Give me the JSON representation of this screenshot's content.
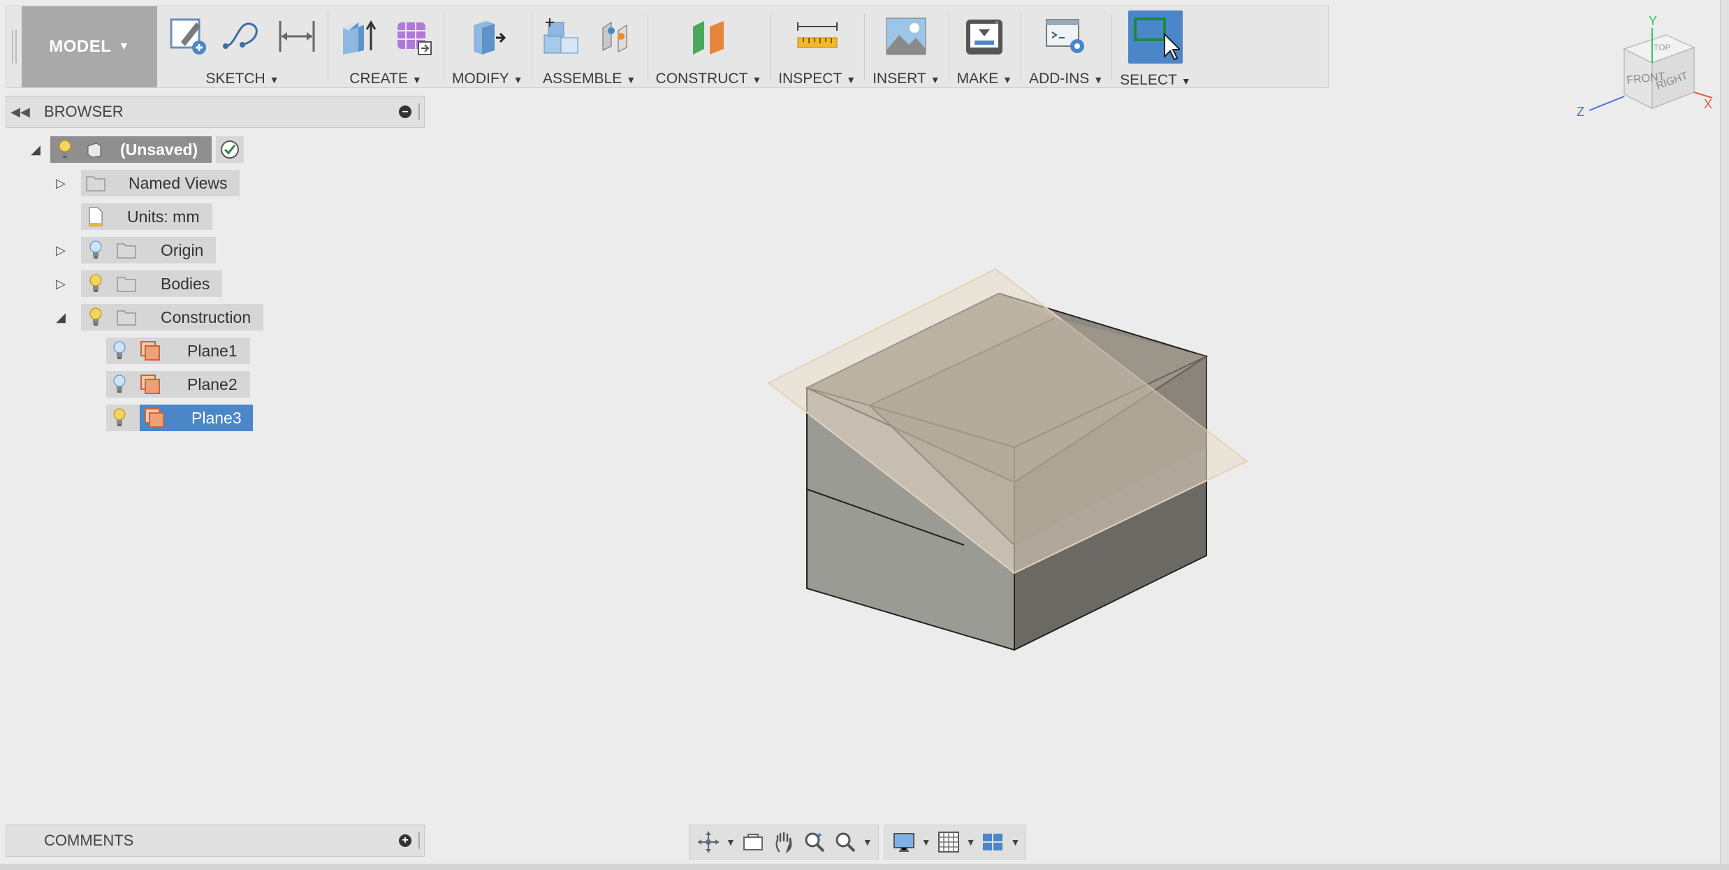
{
  "toolbar": {
    "workspace": "MODEL",
    "groups": [
      {
        "id": "sketch",
        "label": "SKETCH"
      },
      {
        "id": "create",
        "label": "CREATE"
      },
      {
        "id": "modify",
        "label": "MODIFY"
      },
      {
        "id": "assemble",
        "label": "ASSEMBLE"
      },
      {
        "id": "construct",
        "label": "CONSTRUCT"
      },
      {
        "id": "inspect",
        "label": "INSPECT"
      },
      {
        "id": "insert",
        "label": "INSERT"
      },
      {
        "id": "make",
        "label": "MAKE"
      },
      {
        "id": "addins",
        "label": "ADD-INS"
      },
      {
        "id": "select",
        "label": "SELECT"
      }
    ]
  },
  "browser": {
    "title": "BROWSER",
    "root": "(Unsaved)",
    "items": {
      "named_views": "Named Views",
      "units": "Units: mm",
      "origin": "Origin",
      "bodies": "Bodies",
      "construction": "Construction",
      "plane1": "Plane1",
      "plane2": "Plane2",
      "plane3": "Plane3"
    },
    "selected": "Plane3"
  },
  "comments": {
    "title": "COMMENTS"
  },
  "viewcube": {
    "top": "TOP",
    "front": "FRONT",
    "right": "RIGHT",
    "axis_x": "X",
    "axis_y": "Y",
    "axis_z": "Z"
  },
  "colors": {
    "accent": "#4a86c8",
    "bulb_on": "#f4d35e",
    "bulb_off": "#7fb2e5",
    "plane": "#e8a27a"
  }
}
